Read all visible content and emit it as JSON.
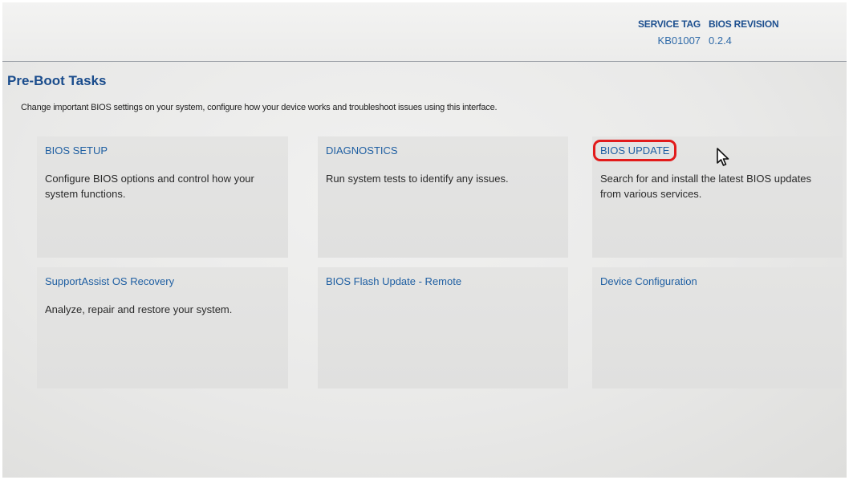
{
  "header": {
    "service_tag_label": "SERVICE TAG",
    "service_tag_value": "KB01007",
    "bios_revision_label": "BIOS REVISION",
    "bios_revision_value": "0.2.4"
  },
  "page": {
    "title": "Pre-Boot Tasks",
    "subtitle": "Change important BIOS settings on your system, configure how your device works and troubleshoot issues using this interface."
  },
  "tiles": [
    {
      "title": "BIOS SETUP",
      "description": "Configure BIOS options and control how your system functions."
    },
    {
      "title": "DIAGNOSTICS",
      "description": "Run system tests to identify any issues."
    },
    {
      "title": "BIOS UPDATE",
      "description": "Search for and install the latest BIOS updates from various services.",
      "highlighted": true
    },
    {
      "title": "SupportAssist OS Recovery",
      "description": "Analyze, repair and restore your system."
    },
    {
      "title": "BIOS Flash Update - Remote",
      "description": ""
    },
    {
      "title": "Device Configuration",
      "description": ""
    }
  ],
  "colors": {
    "accent_blue": "#1f5fa2",
    "title_blue": "#1a4c8c",
    "highlight_red": "#e21b1b",
    "tile_bg": "#e2e2e1"
  },
  "icons": {
    "pointer": "mouse-pointer-icon"
  }
}
